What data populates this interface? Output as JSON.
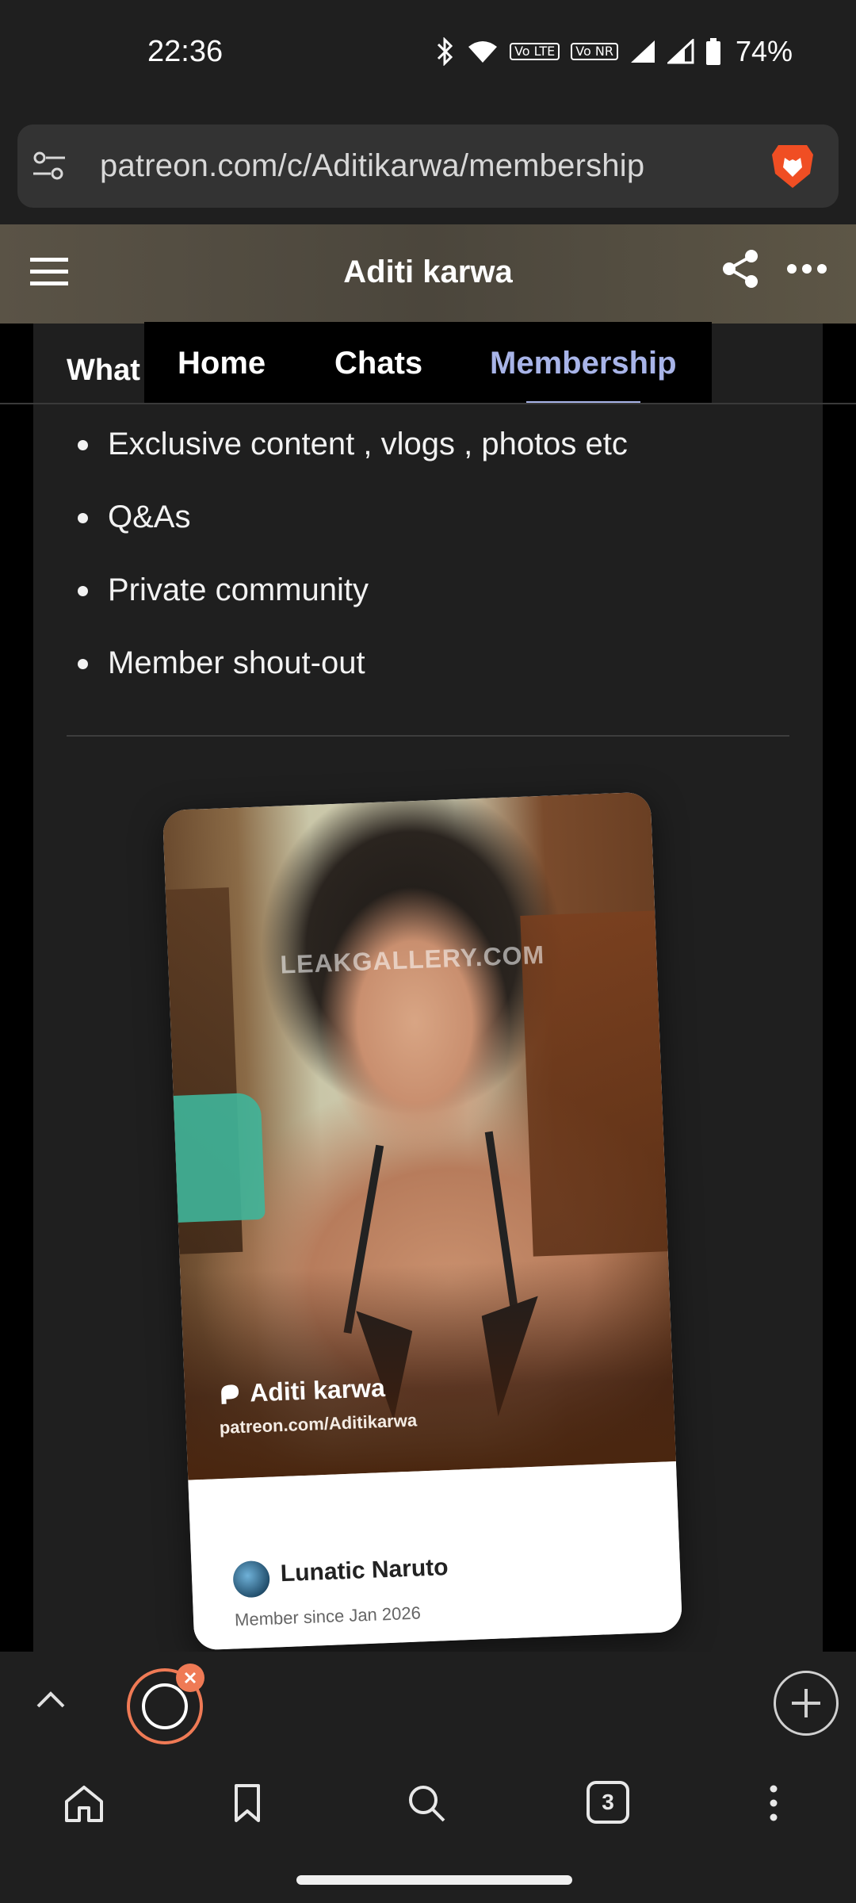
{
  "status_bar": {
    "time": "22:36",
    "battery_percent": "74%",
    "sim1_badge": "Vo LTE",
    "sim2_badge": "Vo NR",
    "icons": [
      "bluetooth-icon",
      "wifi-icon",
      "signal-icon",
      "battery-icon"
    ]
  },
  "address_bar": {
    "url": "patreon.com/c/Aditikarwa/membership",
    "icons": [
      "site-settings-icon",
      "brave-lion-icon"
    ]
  },
  "header": {
    "title": "Aditi karwa",
    "icons": [
      "menu-icon",
      "share-icon",
      "more-icon"
    ]
  },
  "tabs": {
    "left_label": "What",
    "items": [
      {
        "label": "Home"
      },
      {
        "label": "Chats"
      },
      {
        "label": "Membership"
      }
    ],
    "active_index": 2
  },
  "benefits": [
    "Exclusive content , vlogs , photos etc",
    "Q&As",
    "Private community",
    "Member shout-out"
  ],
  "card": {
    "watermark": "LEAKGALLERY.COM",
    "creator_name": "Aditi karwa",
    "creator_url": "patreon.com/Aditikarwa",
    "member_name": "Lunatic Naruto",
    "member_since": "Member since Jan 2026"
  },
  "toolbar": {
    "tab_count": "3",
    "icons": [
      "chevron-up-icon",
      "patreon-tab-icon",
      "close-icon",
      "new-tab-plus-icon",
      "home-icon",
      "bookmark-icon",
      "search-icon",
      "tabs-icon",
      "more-vertical-icon"
    ]
  },
  "colors": {
    "background": "#1f1f1f",
    "active_tab": "#a8b4e8",
    "brave_orange": "#ef7a55"
  }
}
